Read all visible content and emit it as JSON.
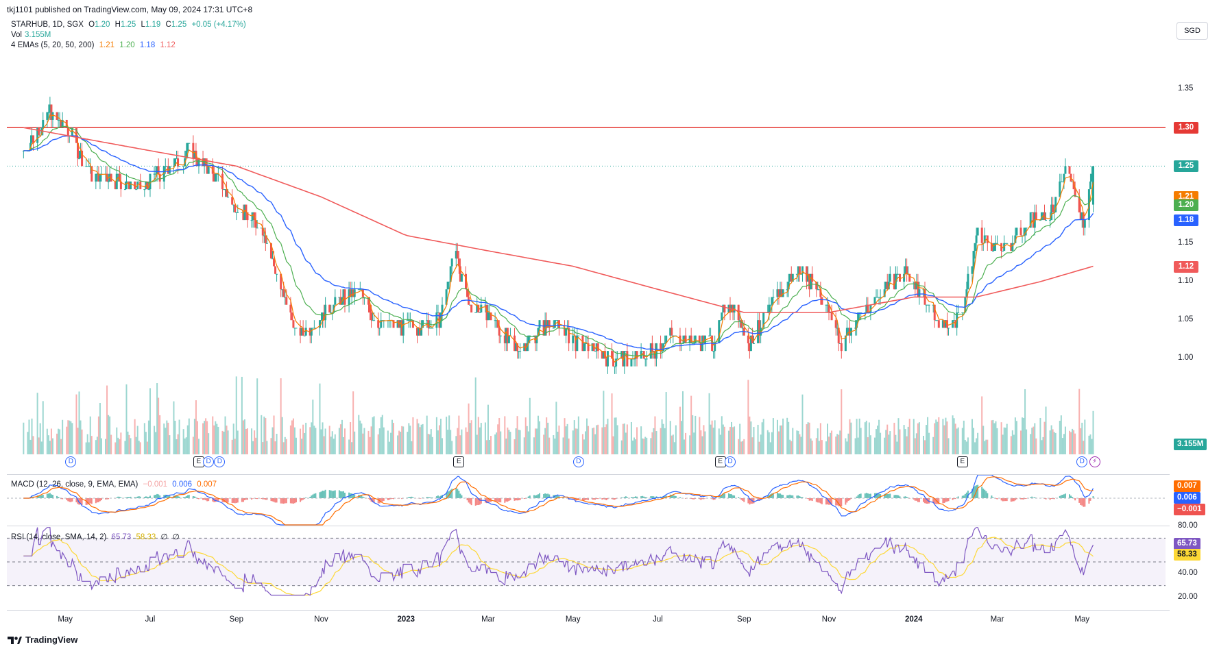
{
  "header": {
    "published": "tkj1101 published on TradingView.com, May 09, 2024 17:31 UTC+8"
  },
  "symbol_line": {
    "symbol": "STARHUB, 1D, SGX",
    "o_label": "O",
    "o": "1.20",
    "h_label": "H",
    "h": "1.25",
    "l_label": "L",
    "l": "1.19",
    "c_label": "C",
    "c": "1.25",
    "change": "+0.05 (+4.17%)"
  },
  "vol_line": {
    "label": "Vol",
    "value": "3.155M"
  },
  "ema_line": {
    "label": "4 EMAs (5, 20, 50, 200)",
    "v5": "1.21",
    "v20": "1.20",
    "v50": "1.18",
    "v200": "1.12"
  },
  "macd_line": {
    "label": "MACD (12, 26, close, 9, EMA, EMA)",
    "hist": "−0.001",
    "macd": "0.006",
    "signal": "0.007"
  },
  "rsi_line": {
    "label": "RSI (14, close, SMA, 14, 2)",
    "rsi": "65.73",
    "ma": "58.33",
    "extra1": "∅",
    "extra2": "∅"
  },
  "currency": "SGD",
  "price_axis": [
    "1.35",
    "1.30",
    "1.25",
    "1.20",
    "1.15",
    "1.10",
    "1.05",
    "1.00"
  ],
  "badges": {
    "resistance": "1.30",
    "close": "1.25",
    "ema5": "1.21",
    "ema20": "1.20",
    "ema50": "1.18",
    "ema200": "1.12",
    "volume": "3.155M",
    "macd_signal": "0.007",
    "macd": "0.006",
    "macd_hist": "−0.001",
    "rsi": "65.73",
    "rsi_ma": "58.33"
  },
  "rsi_axis": [
    "80.00",
    "60.00",
    "40.00",
    "20.00"
  ],
  "x_axis": [
    {
      "label": "May",
      "bold": false
    },
    {
      "label": "Jul",
      "bold": false
    },
    {
      "label": "Sep",
      "bold": false
    },
    {
      "label": "Nov",
      "bold": false
    },
    {
      "label": "2023",
      "bold": true
    },
    {
      "label": "Mar",
      "bold": false
    },
    {
      "label": "May",
      "bold": false
    },
    {
      "label": "Jul",
      "bold": false
    },
    {
      "label": "Sep",
      "bold": false
    },
    {
      "label": "Nov",
      "bold": false
    },
    {
      "label": "2024",
      "bold": true
    },
    {
      "label": "Mar",
      "bold": false
    },
    {
      "label": "May",
      "bold": false
    }
  ],
  "markers": [
    {
      "type": "D",
      "text": "D"
    },
    {
      "type": "E",
      "text": "E"
    },
    {
      "type": "D",
      "text": "D"
    },
    {
      "type": "D",
      "text": "D"
    },
    {
      "type": "E",
      "text": "E"
    },
    {
      "type": "D",
      "text": "D"
    },
    {
      "type": "E",
      "text": "E"
    },
    {
      "type": "D",
      "text": "D"
    },
    {
      "type": "E",
      "text": "E"
    },
    {
      "type": "D",
      "text": "D"
    },
    {
      "type": "S",
      "text": "⚡"
    }
  ],
  "footer": {
    "brand": "TradingView"
  },
  "colors": {
    "up": "#26a69a",
    "down": "#ef5350",
    "ema5": "#f57c00",
    "ema20": "#4caf50",
    "ema50": "#2962ff",
    "ema200": "#f05a5a",
    "resistance": "#e53935",
    "macd": "#2962ff",
    "signal": "#ff6d00",
    "rsi": "#7e57c2",
    "rsi_ma": "#fdd835"
  },
  "chart_data": {
    "type": "candlestick",
    "resistance_level": 1.3,
    "last_close": 1.25,
    "price_ylim": [
      0.98,
      1.37
    ],
    "x_range": [
      "2022-04",
      "2024-06"
    ],
    "anchors": [
      [
        "2022-04-01",
        1.27
      ],
      [
        "2022-04-20",
        1.32
      ],
      [
        "2022-05-05",
        1.29
      ],
      [
        "2022-05-20",
        1.24
      ],
      [
        "2022-06-10",
        1.23
      ],
      [
        "2022-06-25",
        1.22
      ],
      [
        "2022-07-15",
        1.25
      ],
      [
        "2022-07-30",
        1.27
      ],
      [
        "2022-08-15",
        1.24
      ],
      [
        "2022-08-30",
        1.2
      ],
      [
        "2022-09-20",
        1.17
      ],
      [
        "2022-10-05",
        1.08
      ],
      [
        "2022-10-15",
        1.03
      ],
      [
        "2022-11-05",
        1.06
      ],
      [
        "2022-11-28",
        1.09
      ],
      [
        "2022-12-10",
        1.05
      ],
      [
        "2023-01-05",
        1.04
      ],
      [
        "2023-01-25",
        1.05
      ],
      [
        "2023-02-05",
        1.14
      ],
      [
        "2023-02-15",
        1.07
      ],
      [
        "2023-03-01",
        1.06
      ],
      [
        "2023-03-20",
        1.01
      ],
      [
        "2023-04-15",
        1.05
      ],
      [
        "2023-05-05",
        1.02
      ],
      [
        "2023-05-30",
        1.0
      ],
      [
        "2023-06-20",
        1.0
      ],
      [
        "2023-07-10",
        1.03
      ],
      [
        "2023-08-10",
        1.02
      ],
      [
        "2023-08-20",
        1.08
      ],
      [
        "2023-09-05",
        1.02
      ],
      [
        "2023-09-25",
        1.08
      ],
      [
        "2023-10-10",
        1.12
      ],
      [
        "2023-10-25",
        1.09
      ],
      [
        "2023-11-10",
        1.02
      ],
      [
        "2023-11-25",
        1.06
      ],
      [
        "2023-12-15",
        1.1
      ],
      [
        "2023-12-30",
        1.11
      ],
      [
        "2024-01-20",
        1.04
      ],
      [
        "2024-02-05",
        1.06
      ],
      [
        "2024-02-15",
        1.16
      ],
      [
        "2024-03-05",
        1.14
      ],
      [
        "2024-03-25",
        1.18
      ],
      [
        "2024-04-10",
        1.19
      ],
      [
        "2024-04-20",
        1.25
      ],
      [
        "2024-05-02",
        1.18
      ],
      [
        "2024-05-09",
        1.25
      ]
    ],
    "ema200_anchors": [
      [
        "2022-04-01",
        1.3
      ],
      [
        "2022-07-01",
        1.27
      ],
      [
        "2022-09-01",
        1.25
      ],
      [
        "2022-11-01",
        1.21
      ],
      [
        "2023-01-01",
        1.16
      ],
      [
        "2023-03-01",
        1.14
      ],
      [
        "2023-05-01",
        1.12
      ],
      [
        "2023-07-01",
        1.09
      ],
      [
        "2023-09-01",
        1.06
      ],
      [
        "2023-11-01",
        1.06
      ],
      [
        "2024-01-01",
        1.08
      ],
      [
        "2024-02-15",
        1.08
      ],
      [
        "2024-04-01",
        1.1
      ],
      [
        "2024-05-09",
        1.12
      ]
    ],
    "rsi_ylim": [
      20,
      80
    ],
    "rsi_bands": [
      30,
      50,
      70
    ],
    "macd_last": {
      "hist": -0.001,
      "macd": 0.006,
      "signal": 0.007
    },
    "rsi_last": {
      "rsi": 65.73,
      "ma": 58.33
    }
  }
}
